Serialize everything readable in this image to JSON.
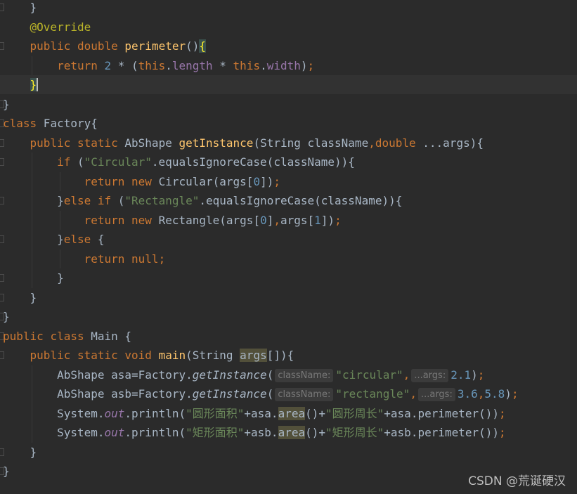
{
  "editor": {
    "lines": [
      "    }",
      "    @Override",
      "    public double perimeter(){",
      "        return 2 * (this.length * this.width);",
      "    }",
      "}",
      "class Factory{",
      "    public static AbShape getInstance(String className,double ...args){",
      "        if (\"Circular\".equalsIgnoreCase(className)){",
      "            return new Circular(args[0]);",
      "        }else if (\"Rectangle\".equalsIgnoreCase(className)){",
      "            return new Rectangle(args[0],args[1]);",
      "        }else {",
      "            return null;",
      "        }",
      "    }",
      "}",
      "public class Main {",
      "    public static void main(String args[]){",
      "        AbShape asa=Factory.getInstance( className: \"circular\", ...args: 2.1);",
      "        AbShape asb=Factory.getInstance( className: \"rectangle\", ...args: 3.6,5.8);",
      "        System.out.println(\"圆形面积\"+asa.area()+\"圆形周长\"+asa.perimeter());",
      "        System.out.println(\"矩形面积\"+asb.area()+\"矩形周长\"+asb.perimeter());",
      "    }",
      "}"
    ],
    "hints": {
      "class_name": "className:",
      "args": "...args:"
    }
  },
  "watermark": "CSDN @荒诞硬汉",
  "colors": {
    "background": "#2b2b2b",
    "current_line": "#323232",
    "keyword": "#cc7832",
    "annotation": "#bbb529",
    "method": "#ffc66d",
    "number": "#6897bb",
    "string": "#6a8759",
    "field": "#9876aa",
    "plain": "#a9b7c6"
  }
}
